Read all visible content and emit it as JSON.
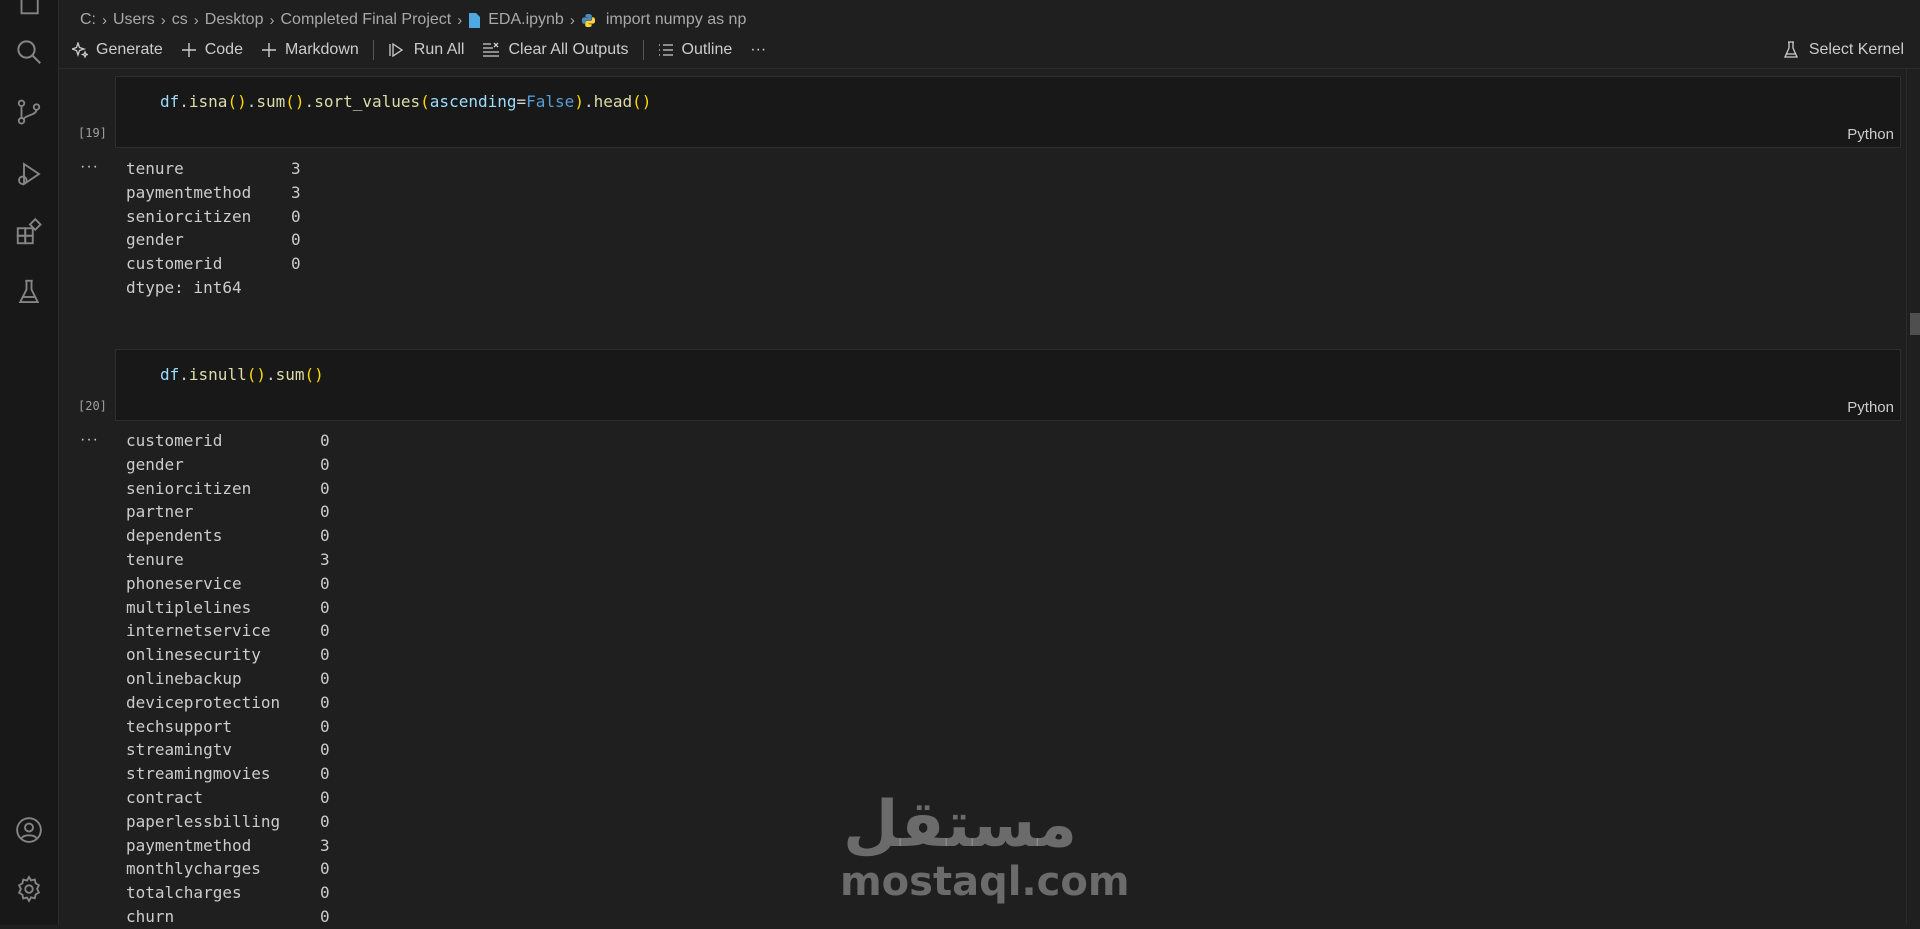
{
  "breadcrumb": {
    "items": [
      "C:",
      "Users",
      "cs",
      "Desktop",
      "Completed Final Project",
      "EDA.ipynb",
      "import numpy as np"
    ]
  },
  "toolbar": {
    "generate": "Generate",
    "code": "Code",
    "markdown": "Markdown",
    "run_all": "Run All",
    "clear_outputs": "Clear All Outputs",
    "outline": "Outline",
    "more": "···",
    "select_kernel": "Select Kernel"
  },
  "cells": [
    {
      "exec_count": "[19]",
      "language": "Python",
      "code_tokens": [
        "df",
        ".",
        "isna",
        "(",
        ")",
        ".",
        "sum",
        "(",
        ")",
        ".",
        "sort_values",
        "(",
        "ascending",
        "=",
        "False",
        ")",
        ".",
        "head",
        "(",
        ")"
      ],
      "output_dots": "···",
      "output": [
        {
          "name": "tenure",
          "value": "3"
        },
        {
          "name": "paymentmethod",
          "value": "3"
        },
        {
          "name": "seniorcitizen",
          "value": "0"
        },
        {
          "name": "gender",
          "value": "0"
        },
        {
          "name": "customerid",
          "value": "0"
        }
      ],
      "dtype": "dtype: int64"
    },
    {
      "exec_count": "[20]",
      "language": "Python",
      "code_tokens": [
        "df",
        ".",
        "isnull",
        "(",
        ")",
        ".",
        "sum",
        "(",
        ")"
      ],
      "output_dots": "···",
      "output": [
        {
          "name": "customerid",
          "value": "0"
        },
        {
          "name": "gender",
          "value": "0"
        },
        {
          "name": "seniorcitizen",
          "value": "0"
        },
        {
          "name": "partner",
          "value": "0"
        },
        {
          "name": "dependents",
          "value": "0"
        },
        {
          "name": "tenure",
          "value": "3"
        },
        {
          "name": "phoneservice",
          "value": "0"
        },
        {
          "name": "multiplelines",
          "value": "0"
        },
        {
          "name": "internetservice",
          "value": "0"
        },
        {
          "name": "onlinesecurity",
          "value": "0"
        },
        {
          "name": "onlinebackup",
          "value": "0"
        },
        {
          "name": "deviceprotection",
          "value": "0"
        },
        {
          "name": "techsupport",
          "value": "0"
        },
        {
          "name": "streamingtv",
          "value": "0"
        },
        {
          "name": "streamingmovies",
          "value": "0"
        },
        {
          "name": "contract",
          "value": "0"
        },
        {
          "name": "paperlessbilling",
          "value": "0"
        },
        {
          "name": "paymentmethod",
          "value": "3"
        },
        {
          "name": "monthlycharges",
          "value": "0"
        },
        {
          "name": "totalcharges",
          "value": "0"
        },
        {
          "name": "churn",
          "value": "0"
        }
      ]
    }
  ],
  "watermark": {
    "arabic": "مستقل",
    "latin": "mostaql.com"
  },
  "icons": {
    "activity_bar": [
      "explorer-icon",
      "search-icon",
      "source-control-icon",
      "run-debug-icon",
      "extensions-icon",
      "testing-icon",
      "account-icon",
      "settings-gear-icon"
    ]
  }
}
